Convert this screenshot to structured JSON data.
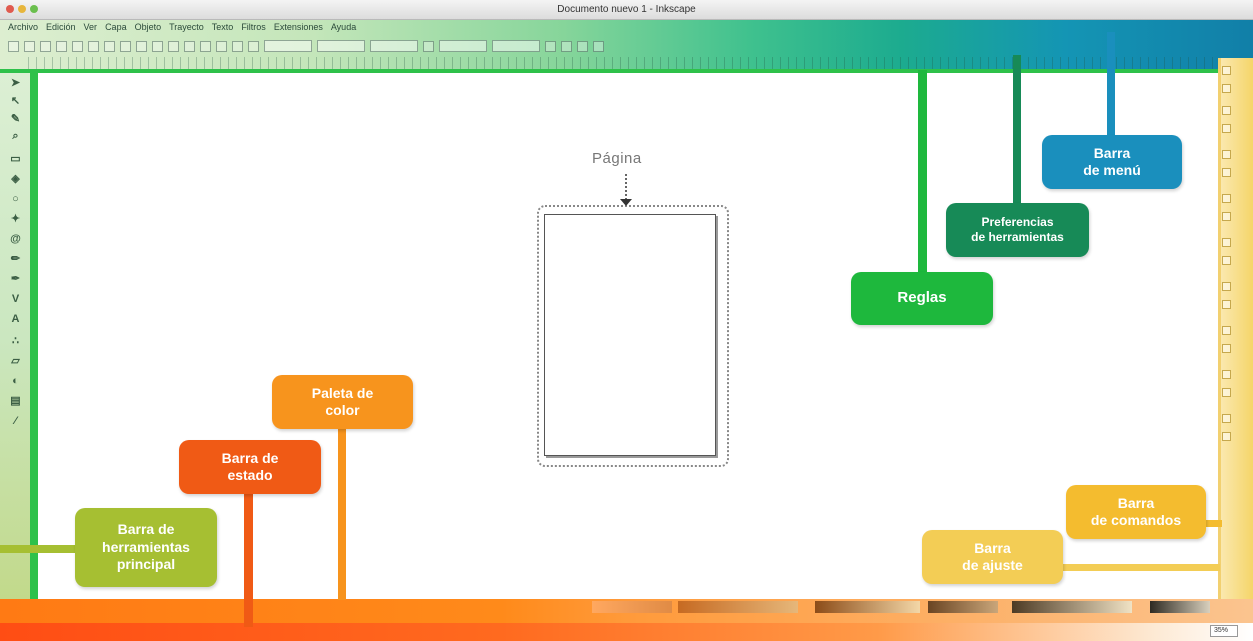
{
  "window": {
    "title": "Documento nuevo 1 - Inkscape"
  },
  "menu": [
    "Archivo",
    "Edición",
    "Ver",
    "Capa",
    "Objeto",
    "Trayecto",
    "Texto",
    "Filtros",
    "Extensiones",
    "Ayuda"
  ],
  "canvas": {
    "page_label": "Página"
  },
  "callouts": {
    "menu_bar": {
      "line1": "Barra",
      "line2": "de menú",
      "color": "#1a8fbd"
    },
    "tool_prefs": {
      "line1": "Preferencias",
      "line2": "de herramientas",
      "color": "#178a57"
    },
    "rulers": {
      "label": "Reglas",
      "color": "#1eb83d"
    },
    "palette": {
      "line1": "Paleta de",
      "line2": "color",
      "color": "#f7941d"
    },
    "status": {
      "line1": "Barra de",
      "line2": "estado",
      "color": "#f05a15"
    },
    "toolbox": {
      "line1": "Barra de",
      "line2": "herramientas",
      "line3": "principal",
      "color": "#a6bf32"
    },
    "commands": {
      "line1": "Barra",
      "line2": "de comandos",
      "color": "#f4bc2f"
    },
    "snap": {
      "line1": "Barra",
      "line2": "de ajuste",
      "color": "#f3cd55"
    }
  },
  "status": {
    "zoom": "35%"
  }
}
